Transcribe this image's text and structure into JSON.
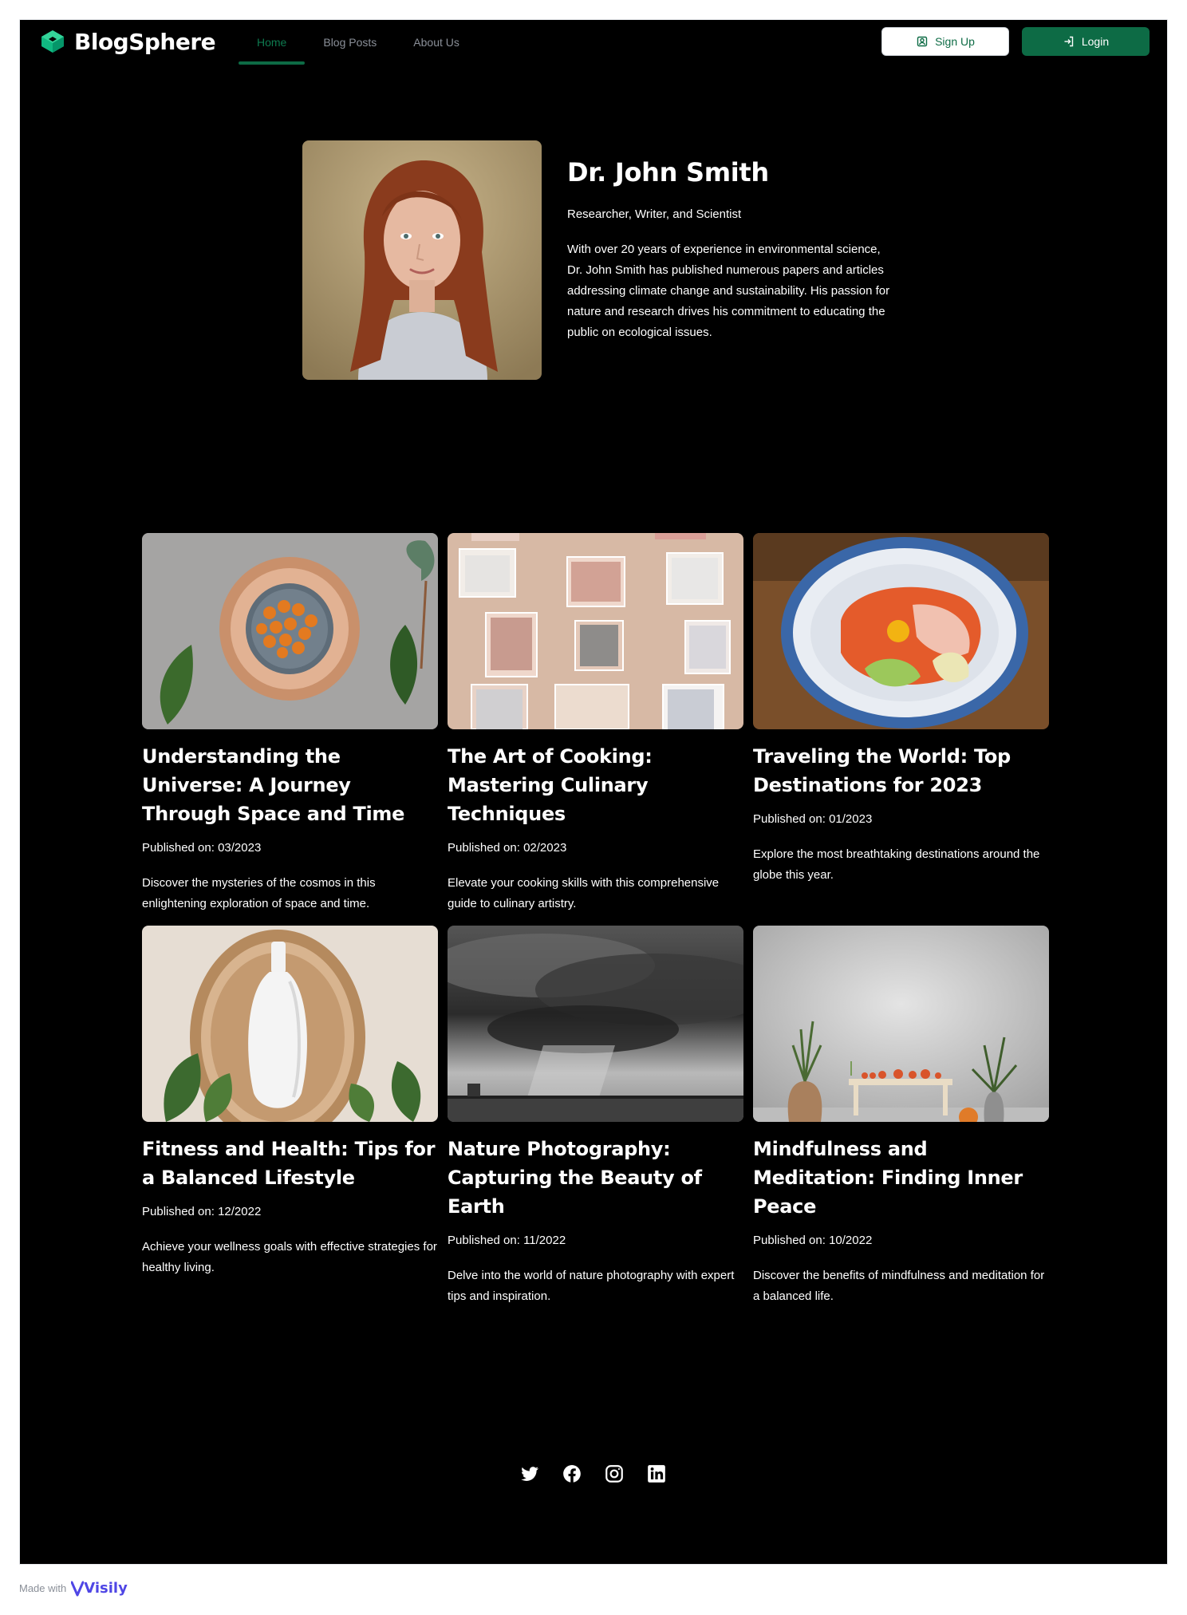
{
  "brand": {
    "name": "BlogSphere",
    "color": "#10b981"
  },
  "nav": {
    "items": [
      {
        "label": "Home",
        "active": true
      },
      {
        "label": "Blog Posts",
        "active": false
      },
      {
        "label": "About Us",
        "active": false
      }
    ]
  },
  "actions": {
    "signup_label": "Sign Up",
    "login_label": "Login",
    "accent": "#0d6b45"
  },
  "profile": {
    "name": "Dr. John Smith",
    "role": "Researcher, Writer, and Scientist",
    "bio": "With over 20 years of experience in environmental science, Dr. John Smith has published numerous papers and articles addressing climate change and sustainability. His passion for nature and research drives his commitment to educating the public on ecological issues."
  },
  "posts": [
    {
      "title": "Understanding the Universe: A Journey Through Space and Time",
      "date": "Published on: 03/2023",
      "description": "Discover the mysteries of the cosmos in this enlightening exploration of space and time."
    },
    {
      "title": "The Art of Cooking: Mastering Culinary Techniques",
      "date": "Published on: 02/2023",
      "description": "Elevate your cooking skills with this comprehensive guide to culinary artistry."
    },
    {
      "title": "Traveling the World: Top Destinations for 2023",
      "date": "Published on: 01/2023",
      "description": "Explore the most breathtaking destinations around the globe this year."
    },
    {
      "title": "Fitness and Health: Tips for a Balanced Lifestyle",
      "date": "Published on: 12/2022",
      "description": "Achieve your wellness goals with effective strategies for healthy living."
    },
    {
      "title": "Nature Photography: Capturing the Beauty of Earth",
      "date": "Published on: 11/2022",
      "description": "Delve into the world of nature photography with expert tips and inspiration."
    },
    {
      "title": "Mindfulness and Meditation: Finding Inner Peace",
      "date": "Published on: 10/2022",
      "description": "Discover the benefits of mindfulness and meditation for a balanced life."
    }
  ],
  "social": [
    "twitter-icon",
    "facebook-icon",
    "instagram-icon",
    "linkedin-icon"
  ],
  "footer": {
    "made_with": "Made with",
    "made_with_brand": "Visily"
  }
}
